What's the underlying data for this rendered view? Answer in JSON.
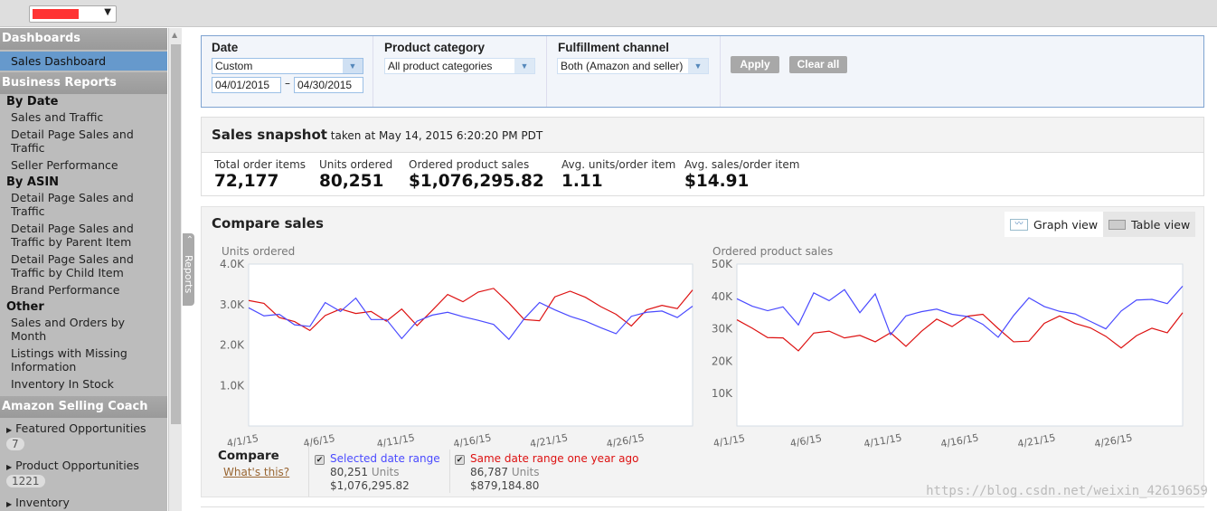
{
  "topbar": {
    "marketplace_select": "redacted"
  },
  "sidebar": {
    "sections": [
      {
        "title": "Dashboards"
      },
      {
        "title": "Business Reports"
      },
      {
        "title": "Amazon Selling Coach"
      }
    ],
    "active": "Sales Dashboard",
    "by_date": {
      "label": "By Date",
      "items": [
        "Sales and Traffic",
        "Detail Page Sales and Traffic",
        "Seller Performance"
      ]
    },
    "by_asin": {
      "label": "By ASIN",
      "items": [
        "Detail Page Sales and Traffic",
        "Detail Page Sales and Traffic by Parent Item",
        "Detail Page Sales and Traffic by Child Item",
        "Brand Performance"
      ]
    },
    "other": {
      "label": "Other",
      "items": [
        "Sales and Orders by Month",
        "Listings with Missing Information",
        "Inventory In Stock"
      ]
    },
    "coach": [
      {
        "label": "Featured Opportunities",
        "count": "7"
      },
      {
        "label": "Product Opportunities",
        "count": "1221"
      },
      {
        "label": "Inventory"
      }
    ],
    "reports_tab": "Reports"
  },
  "filters": {
    "date_label": "Date",
    "date_value": "Custom",
    "from": "04/01/2015",
    "to": "04/30/2015",
    "dash": "–",
    "category_label": "Product category",
    "category_value": "All product categories",
    "channel_label": "Fulfillment channel",
    "channel_value": "Both (Amazon and seller)",
    "apply": "Apply",
    "clear": "Clear all"
  },
  "snapshot": {
    "title": "Sales snapshot",
    "taken": "taken at May 14, 2015 6:20:20 PM PDT",
    "metrics": [
      {
        "label": "Total order items",
        "value": "72,177"
      },
      {
        "label": "Units ordered",
        "value": "80,251"
      },
      {
        "label": "Ordered product sales",
        "value": "$1,076,295.82"
      },
      {
        "label": "Avg. units/order item",
        "value": "1.11"
      },
      {
        "label": "Avg. sales/order item",
        "value": "$14.91"
      }
    ]
  },
  "compare": {
    "title": "Compare sales",
    "graph_view": "Graph view",
    "table_view": "Table view",
    "compare_label": "Compare",
    "whats_this": "What's this?",
    "selected": {
      "label": "Selected date range",
      "units": "80,251",
      "units_word": "Units",
      "sales": "$1,076,295.82",
      "color": "#4a4aff"
    },
    "previous": {
      "label": "Same date range one year ago",
      "units": "86,787",
      "units_word": "Units",
      "sales": "$879,184.80",
      "color": "#dd1111"
    }
  },
  "chart_data": [
    {
      "type": "line",
      "title": "Units ordered",
      "ylim": [
        0,
        4000
      ],
      "yticks": [
        "1.0K",
        "2.0K",
        "3.0K",
        "4.0K"
      ],
      "ytick_values": [
        1000,
        2000,
        3000,
        4000
      ],
      "xticks": [
        "4/1/15",
        "4/6/15",
        "4/11/15",
        "4/16/15",
        "4/21/15",
        "4/26/15"
      ],
      "series": [
        {
          "name": "Selected date range",
          "color": "#4a4aff",
          "values": [
            2920,
            2720,
            2760,
            2500,
            2460,
            3050,
            2830,
            3160,
            2630,
            2630,
            2160,
            2590,
            2740,
            2810,
            2700,
            2610,
            2510,
            2140,
            2650,
            3050,
            2870,
            2710,
            2590,
            2430,
            2280,
            2710,
            2810,
            2840,
            2680,
            2960
          ]
        },
        {
          "name": "Same date range one year ago",
          "color": "#dd1111",
          "values": [
            3100,
            3030,
            2680,
            2580,
            2360,
            2730,
            2890,
            2780,
            2830,
            2590,
            2890,
            2480,
            2860,
            3250,
            3070,
            3310,
            3400,
            3040,
            2630,
            2600,
            3190,
            3330,
            3180,
            2950,
            2760,
            2470,
            2870,
            2980,
            2900,
            3360
          ]
        }
      ]
    },
    {
      "type": "line",
      "title": "Ordered product sales",
      "ylim": [
        0,
        50000
      ],
      "yticks": [
        "10K",
        "20K",
        "30K",
        "40K",
        "50K"
      ],
      "ytick_values": [
        10000,
        20000,
        30000,
        40000,
        50000
      ],
      "xticks": [
        "4/1/15",
        "4/6/15",
        "4/11/15",
        "4/16/15",
        "4/21/15",
        "4/26/15"
      ],
      "series": [
        {
          "name": "Selected date range",
          "color": "#4a4aff",
          "values": [
            39300,
            37000,
            35600,
            36800,
            31200,
            41100,
            38700,
            42100,
            35000,
            40800,
            28200,
            34000,
            35300,
            36100,
            34500,
            33800,
            31400,
            27400,
            34100,
            39600,
            36900,
            35400,
            34600,
            32300,
            30000,
            35500,
            38900,
            39100,
            37800,
            43200
          ]
        },
        {
          "name": "Same date range one year ago",
          "color": "#dd1111",
          "values": [
            32800,
            30200,
            27300,
            27200,
            23200,
            28700,
            29300,
            27200,
            28000,
            26000,
            28800,
            24600,
            29200,
            33000,
            30700,
            33900,
            34500,
            30100,
            26000,
            26200,
            31700,
            34000,
            31700,
            30300,
            27700,
            24100,
            27900,
            30200,
            28800,
            35000
          ]
        }
      ]
    }
  ],
  "watermark": "https://blog.csdn.net/weixin_42619659"
}
